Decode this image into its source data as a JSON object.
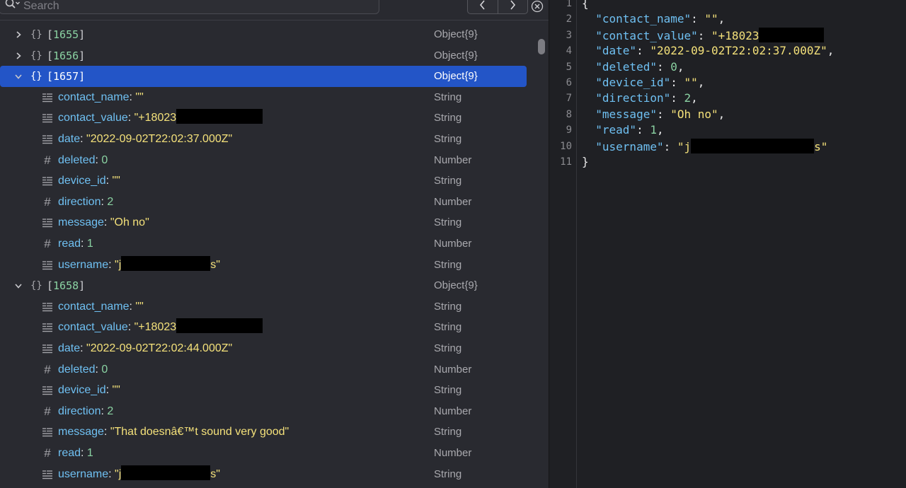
{
  "search": {
    "placeholder": "Search"
  },
  "icons": [
    "search-icon",
    "chevron-left-icon",
    "chevron-right-icon",
    "clear-icon",
    "braces-icon",
    "string-icon",
    "number-icon",
    "disclosure-icon"
  ],
  "tree": {
    "rows": [
      {
        "kind": "object",
        "index": "1655",
        "type": "Object{9}"
      },
      {
        "kind": "object",
        "index": "1656",
        "type": "Object{9}"
      },
      {
        "kind": "object",
        "index": "1657",
        "type": "Object{9}",
        "selected": true
      },
      {
        "kind": "field",
        "key": "contact_name",
        "value": "\"\"",
        "type": "String"
      },
      {
        "kind": "field",
        "key": "contact_value",
        "value": "\"+18023",
        "type": "String",
        "redacted": true
      },
      {
        "kind": "field",
        "key": "date",
        "value": "\"2022-09-02T22:02:37.000Z\"",
        "type": "String"
      },
      {
        "kind": "field",
        "key": "deleted",
        "value": "0",
        "type": "Number"
      },
      {
        "kind": "field",
        "key": "device_id",
        "value": "\"\"",
        "type": "String"
      },
      {
        "kind": "field",
        "key": "direction",
        "value": "2",
        "type": "Number"
      },
      {
        "kind": "field",
        "key": "message",
        "value": "\"Oh no\"",
        "type": "String"
      },
      {
        "kind": "field",
        "key": "read",
        "value": "1",
        "type": "Number"
      },
      {
        "kind": "field",
        "key": "username",
        "value": "\"j",
        "suffix": "s\"",
        "type": "String",
        "redacted": true
      },
      {
        "kind": "object",
        "index": "1658",
        "type": "Object{9}"
      },
      {
        "kind": "field",
        "key": "contact_name",
        "value": "\"\"",
        "type": "String"
      },
      {
        "kind": "field",
        "key": "contact_value",
        "value": "\"+18023",
        "type": "String",
        "redacted": true
      },
      {
        "kind": "field",
        "key": "date",
        "value": "\"2022-09-02T22:02:44.000Z\"",
        "type": "String"
      },
      {
        "kind": "field",
        "key": "deleted",
        "value": "0",
        "type": "Number"
      },
      {
        "kind": "field",
        "key": "device_id",
        "value": "\"\"",
        "type": "String"
      },
      {
        "kind": "field",
        "key": "direction",
        "value": "2",
        "type": "Number"
      },
      {
        "kind": "field",
        "key": "message",
        "value": "\"That doesnâ€™t sound very good\"",
        "type": "String"
      },
      {
        "kind": "field",
        "key": "read",
        "value": "1",
        "type": "Number"
      },
      {
        "kind": "field",
        "key": "username",
        "value": "\"j",
        "suffix": "s\"",
        "type": "String",
        "redacted": true
      }
    ]
  },
  "editor": {
    "lines": [
      {
        "n": "1",
        "text": "{"
      },
      {
        "n": "2",
        "key": "\"contact_name\"",
        "value": "\"\"",
        "vtype": "s",
        "comma": true
      },
      {
        "n": "3",
        "key": "\"contact_value\"",
        "value": "\"+18023",
        "vtype": "s",
        "redacted": true
      },
      {
        "n": "4",
        "key": "\"date\"",
        "value": "\"2022-09-02T22:02:37.000Z\"",
        "vtype": "s",
        "comma": true
      },
      {
        "n": "5",
        "key": "\"deleted\"",
        "value": "0",
        "vtype": "n",
        "comma": true
      },
      {
        "n": "6",
        "key": "\"device_id\"",
        "value": "\"\"",
        "vtype": "s",
        "comma": true
      },
      {
        "n": "7",
        "key": "\"direction\"",
        "value": "2",
        "vtype": "n",
        "comma": true
      },
      {
        "n": "8",
        "key": "\"message\"",
        "value": "\"Oh no\"",
        "vtype": "s",
        "comma": true
      },
      {
        "n": "9",
        "key": "\"read\"",
        "value": "1",
        "vtype": "n",
        "comma": true
      },
      {
        "n": "10",
        "key": "\"username\"",
        "value": "\"j",
        "suffix": "s\"",
        "vtype": "s",
        "redacted": true
      },
      {
        "n": "11",
        "text": "}"
      }
    ]
  }
}
